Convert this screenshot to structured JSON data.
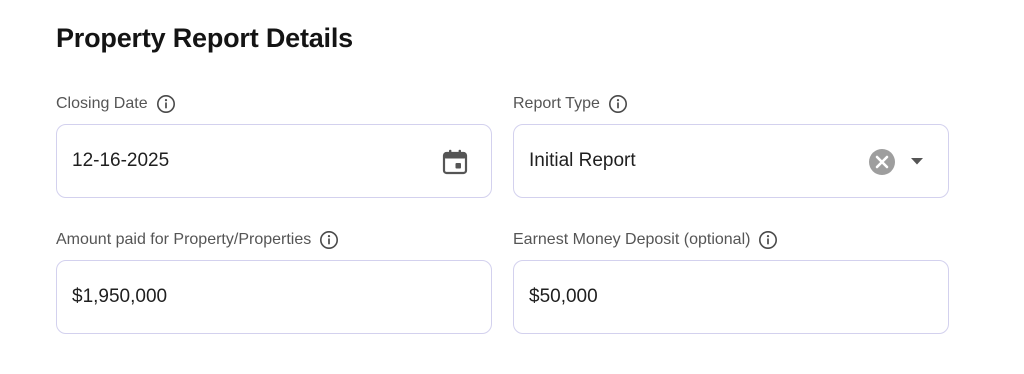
{
  "form": {
    "title": "Property Report Details",
    "closing_date": {
      "label": "Closing Date",
      "value": "12-16-2025",
      "icon": "calendar-icon"
    },
    "report_type": {
      "label": "Report Type",
      "selected": "Initial Report",
      "icons": [
        "clear-icon",
        "chevron-down-icon"
      ]
    },
    "amount_paid": {
      "label": "Amount paid for Property/Properties",
      "value": "$1,950,000"
    },
    "earnest_money": {
      "label": "Earnest Money Deposit (optional)",
      "value": "$50,000"
    }
  },
  "colors": {
    "border": "#d3d1ee",
    "label": "#555555",
    "icon": "#555555",
    "clear_icon_bg": "#9e9e9e"
  }
}
